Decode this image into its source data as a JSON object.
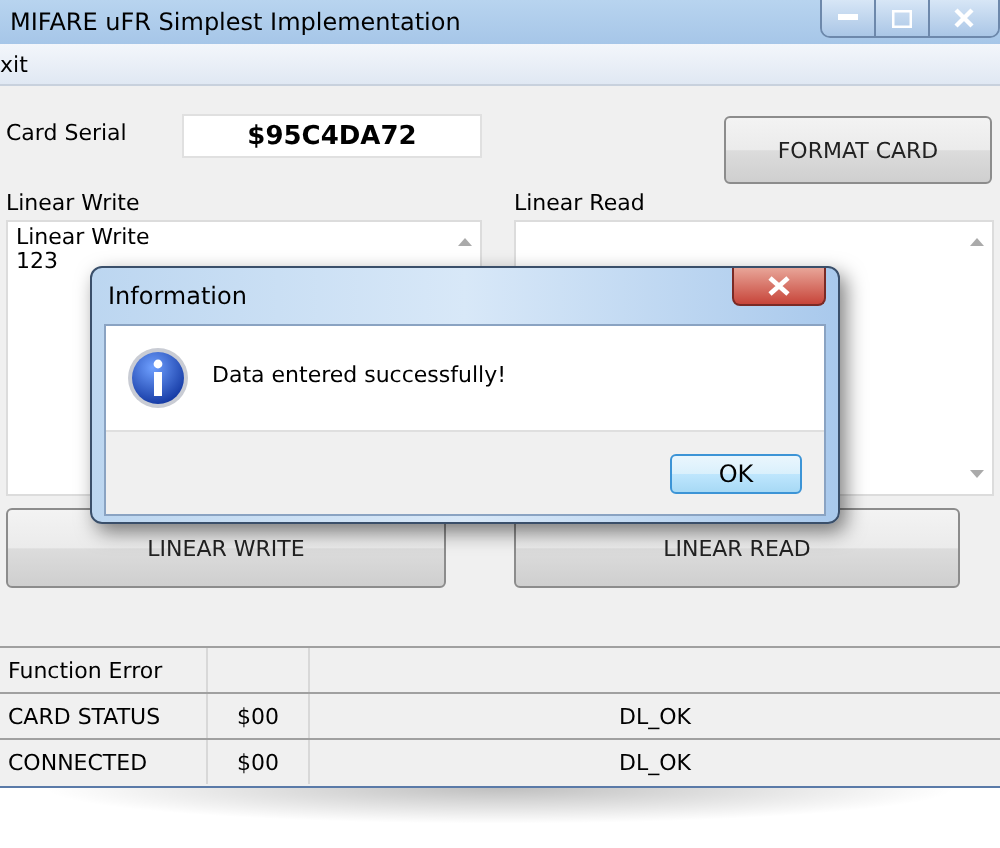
{
  "window": {
    "title": "MIFARE uFR Simplest Implementation"
  },
  "menu": [
    "xit"
  ],
  "card_serial": {
    "label": "Card Serial",
    "value": "$95C4DA72"
  },
  "format_button": "FORMAT CARD",
  "linear_write": {
    "label": "Linear Write",
    "lines": [
      "Linear Write",
      "123"
    ]
  },
  "linear_read": {
    "label": "Linear Read"
  },
  "buttons": [
    "LINEAR WRITE",
    "LINEAR READ"
  ],
  "status_table": {
    "rows": [
      {
        "cells": [
          "Function Error",
          "",
          ""
        ]
      },
      {
        "cells": [
          "CARD STATUS",
          "$00",
          "DL_OK"
        ]
      },
      {
        "cells": [
          "CONNECTED",
          "$00",
          "DL_OK"
        ]
      }
    ]
  },
  "dialog": {
    "title": "Information",
    "message": "Data entered successfully!",
    "button": "OK"
  }
}
